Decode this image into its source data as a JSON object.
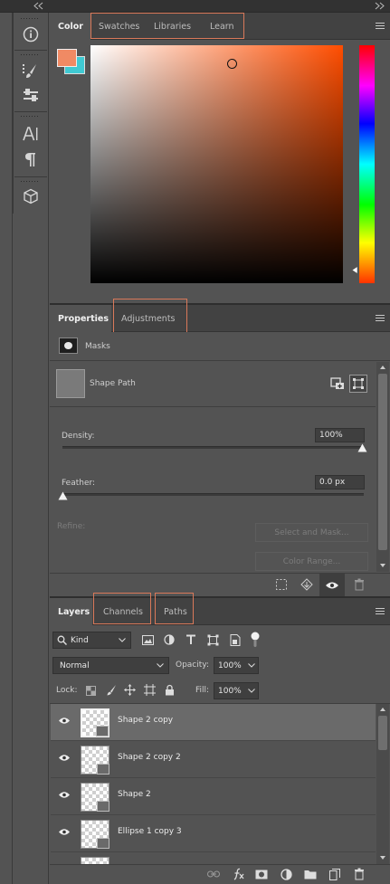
{
  "colors": {
    "accent_box": "#d9795a",
    "foreground": "#f08a64",
    "background": "#3fc9d2"
  },
  "color_panel": {
    "tabs": [
      {
        "label": "Color",
        "active": true
      },
      {
        "label": "Swatches"
      },
      {
        "label": "Libraries"
      },
      {
        "label": "Learn"
      }
    ]
  },
  "properties_panel": {
    "tabs": [
      {
        "label": "Properties",
        "active": true
      },
      {
        "label": "Adjustments"
      }
    ],
    "masks_label": "Masks",
    "shape_path_label": "Shape Path",
    "density": {
      "label": "Density:",
      "value": "100%"
    },
    "feather": {
      "label": "Feather:",
      "value": "0.0 px"
    },
    "refine_label": "Refine:",
    "select_and_mask": "Select and Mask...",
    "color_range": "Color Range..."
  },
  "layers_panel": {
    "tabs": [
      {
        "label": "Layers",
        "active": true
      },
      {
        "label": "Channels"
      },
      {
        "label": "Paths"
      }
    ],
    "filter_kind": "Kind",
    "blend_mode": "Normal",
    "opacity_label": "Opacity:",
    "opacity_value": "100%",
    "lock_label": "Lock:",
    "fill_label": "Fill:",
    "fill_value": "100%",
    "layers": [
      {
        "name": "Shape 2 copy",
        "selected": true
      },
      {
        "name": "Shape 2 copy 2"
      },
      {
        "name": "Shape 2"
      },
      {
        "name": "Ellipse 1 copy 3"
      }
    ]
  }
}
